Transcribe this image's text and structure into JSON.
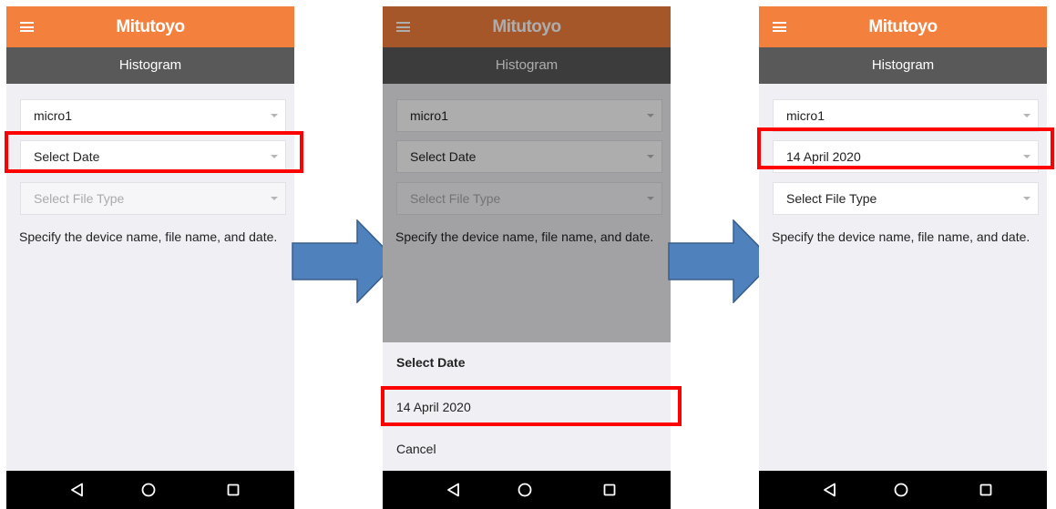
{
  "screens": [
    {
      "brand": "Mitutoyo",
      "title": "Histogram",
      "device": "micro1",
      "date": "Select Date",
      "file_type": "Select File Type",
      "hint": "Specify the device name, file name, and date."
    },
    {
      "brand": "Mitutoyo",
      "title": "Histogram",
      "device": "micro1",
      "date": "Select Date",
      "file_type": "Select File Type",
      "hint": "Specify the device name, file name, and date.",
      "sheet": {
        "title": "Select Date",
        "option": "14 April 2020",
        "cancel": "Cancel"
      }
    },
    {
      "brand": "Mitutoyo",
      "title": "Histogram",
      "device": "micro1",
      "date": "14 April 2020",
      "file_type": "Select File Type",
      "hint": "Specify the device name, file name, and date."
    }
  ],
  "icons": {
    "menu": "hamburger-menu-icon",
    "dropdown": "chevron-down-icon",
    "back": "nav-back-triangle-icon",
    "home": "nav-home-circle-icon",
    "recents": "nav-recents-square-icon",
    "step_arrow": "right-arrow-icon"
  },
  "colors": {
    "app_bar": "#f4803d",
    "title_bar": "#595959",
    "background": "#efeff4",
    "highlight": "#ff0000",
    "step_arrow": "#4f81bd"
  }
}
